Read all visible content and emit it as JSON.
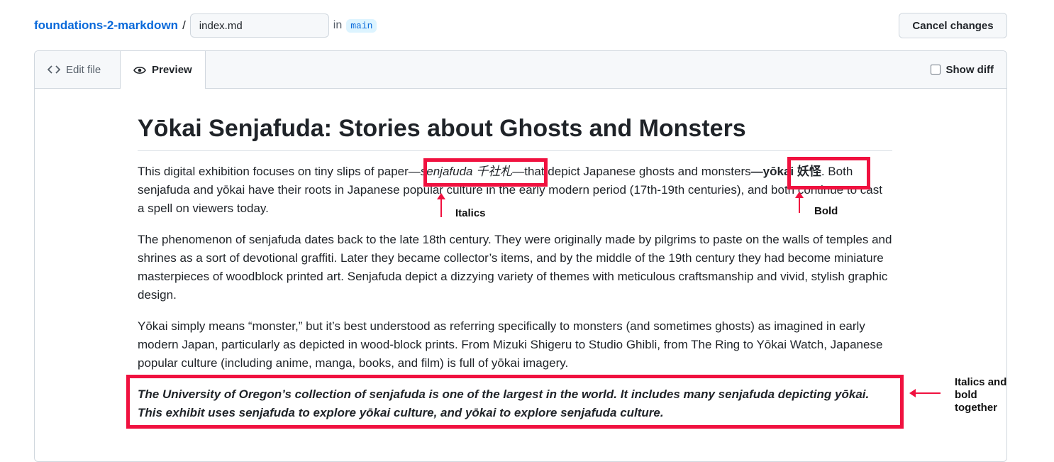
{
  "header": {
    "repo": "foundations-2-markdown",
    "separator": "/",
    "filename": "index.md",
    "in_label": "in",
    "branch": "main",
    "cancel_label": "Cancel changes"
  },
  "tabs": [
    {
      "label": "Edit file",
      "icon": "code-icon",
      "active": false
    },
    {
      "label": "Preview",
      "icon": "eye-icon",
      "active": true
    }
  ],
  "show_diff_label": "Show diff",
  "document": {
    "title": "Yōkai Senjafuda: Stories about Ghosts and Monsters",
    "p1": {
      "a": "This digital exhibition focuses on tiny slips of paper",
      "italic": "—senjafuda 千社札—",
      "b": "that depict Japanese ghosts and monsters",
      "bold": "—yōkai 妖怪",
      "c": ". Both senjafuda and yōkai have their roots in Japanese popular culture in the early modern period (17th-19th centuries), and both continue to cast a spell on viewers today."
    },
    "p2": "The phenomenon of senjafuda dates back to the late 18th century. They were originally made by pilgrims to paste on the walls of temples and shrines as a sort of devotional graffiti. Later they became collector’s items, and by the middle of the 19th century they had become miniature masterpieces of woodblock printed art. Senjafuda depict a dizzying variety of themes with meticulous craftsmanship and vivid, stylish graphic design.",
    "p3": "Yōkai simply means “monster,” but it’s best understood as referring specifically to monsters (and sometimes ghosts) as imagined in early modern Japan, particularly as depicted in wood-block prints. From Mizuki Shigeru to Studio Ghibli, from The Ring to Yōkai Watch, Japanese popular culture (including anime, manga, books, and film) is full of yōkai imagery.",
    "p4": "The University of Oregon’s collection of senjafuda is one of the largest in the world. It includes many senjafuda depicting yōkai. This exhibit uses senjafuda to explore yōkai culture, and yōkai to explore senjafuda culture."
  },
  "annotations": {
    "italics": "Italics",
    "bold": "Bold",
    "both_line1": "Italics and",
    "both_line2": "bold",
    "both_line3": "together",
    "color": "#f0113f"
  }
}
